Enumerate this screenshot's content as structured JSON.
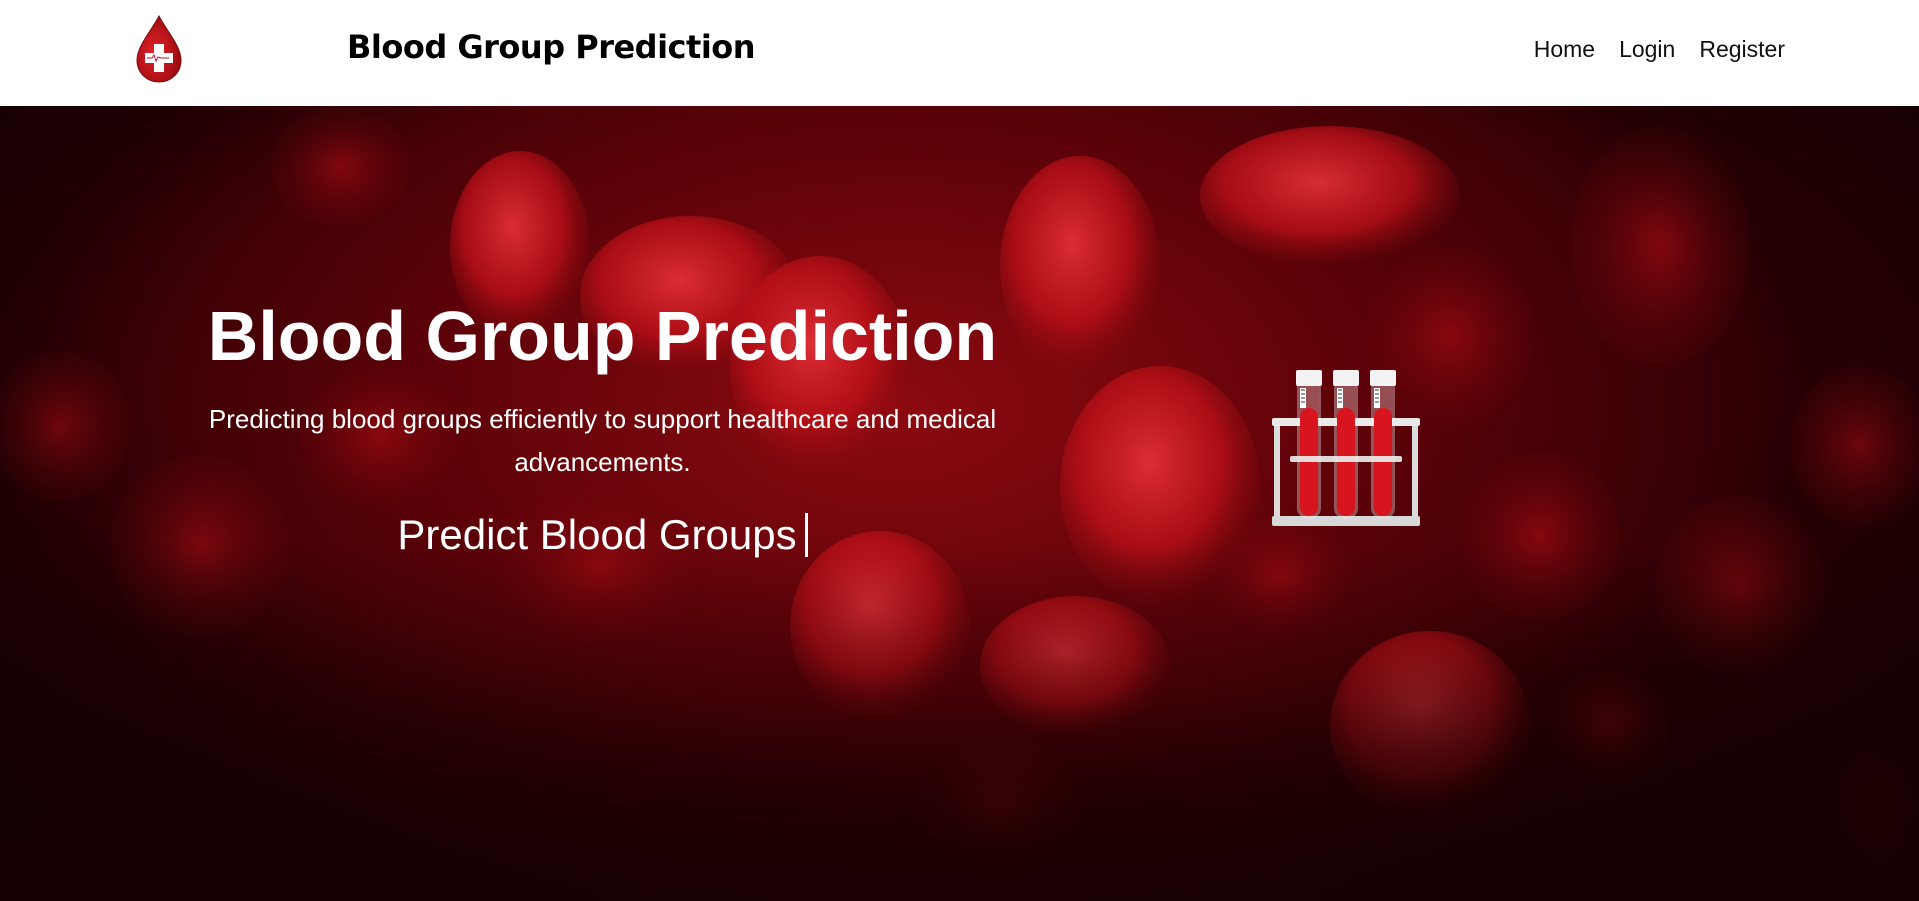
{
  "header": {
    "logo_icon": "blood-drop-cross-icon",
    "brand": "Blood Group Prediction",
    "nav": [
      {
        "label": "Home"
      },
      {
        "label": "Login"
      },
      {
        "label": "Register"
      }
    ]
  },
  "hero": {
    "title": "Blood Group Prediction",
    "subtitle": "Predicting blood groups efficiently to support healthcare and medical advancements.",
    "typing_text": "Predict Blood Groups",
    "illustration_icon": "test-tubes-icon"
  },
  "colors": {
    "accent": "#c8102e",
    "hero_dark": "#2a0004",
    "text_light": "#ffffff"
  }
}
